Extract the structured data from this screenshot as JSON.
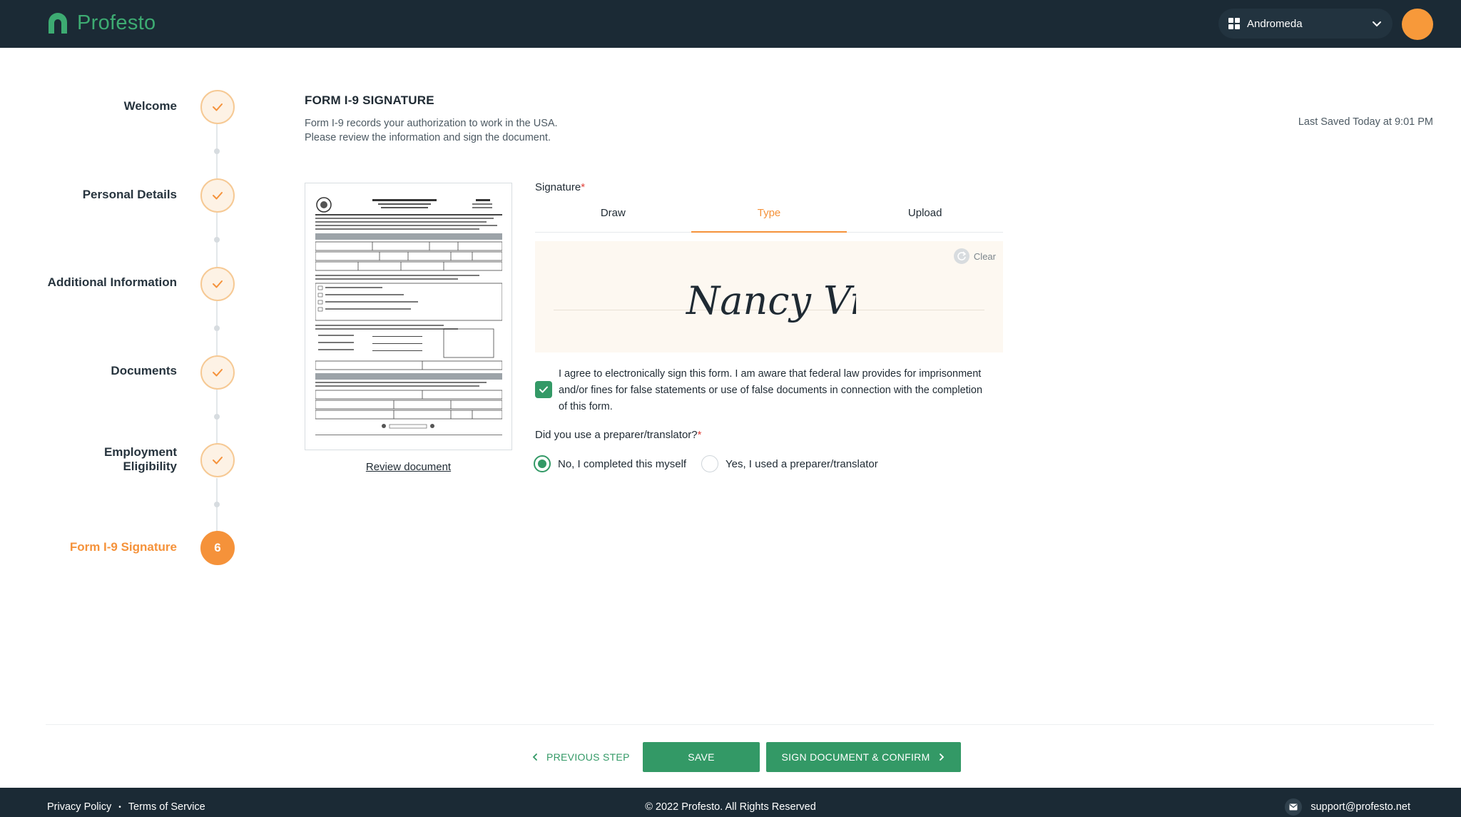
{
  "header": {
    "brand": "Profesto",
    "workspace": "Andromeda"
  },
  "steps": [
    {
      "label": "Welcome",
      "status": "done"
    },
    {
      "label": "Personal Details",
      "status": "done"
    },
    {
      "label": "Additional Information",
      "status": "done"
    },
    {
      "label": "Documents",
      "status": "done"
    },
    {
      "label": "Employment Eligibility",
      "status": "done"
    },
    {
      "label": "Form I-9 Signature",
      "status": "active",
      "number": "6"
    }
  ],
  "main": {
    "title": "FORM I-9 SIGNATURE",
    "desc_line1": "Form I-9 records your authorization to work in the USA.",
    "desc_line2": "Please review the information and sign the document.",
    "last_saved": "Last Saved Today at 9:01 PM",
    "review_link": "Review document",
    "signature_label": "Signature",
    "required_mark": "*",
    "tabs": [
      {
        "label": "Draw",
        "active": false
      },
      {
        "label": "Type",
        "active": true
      },
      {
        "label": "Upload",
        "active": false
      }
    ],
    "clear_label": "Clear",
    "typed_signature": "Nancy Vidal",
    "agree_text": "I agree to electronically sign this form. I am aware that federal law provides for imprisonment and/or fines for false statements or use of false documents in connection with the completion of this form.",
    "agree_checked": true,
    "preparer_question": "Did you use a preparer/translator?",
    "preparer_options": [
      {
        "label": "No, I completed this myself",
        "selected": true
      },
      {
        "label": "Yes, I used a preparer/translator",
        "selected": false
      }
    ]
  },
  "actions": {
    "previous": "PREVIOUS STEP",
    "save": "SAVE",
    "sign": "SIGN DOCUMENT & CONFIRM"
  },
  "footer": {
    "privacy": "Privacy Policy",
    "separator": "•",
    "terms": "Terms of Service",
    "copyright": "© 2022 Profesto. All Rights Reserved",
    "support_email": "support@profesto.net"
  },
  "colors": {
    "brand_green": "#339966",
    "accent_orange": "#f5923a",
    "header_bg": "#1b2a35"
  },
  "icons": {
    "logo": "profesto-logo-icon",
    "workspace": "grid-icon",
    "dropdown": "chevron-down-icon",
    "step_done": "check-icon",
    "clear": "refresh-icon",
    "prev": "chevron-left-icon",
    "next": "chevron-right-icon",
    "mail": "mail-icon"
  }
}
